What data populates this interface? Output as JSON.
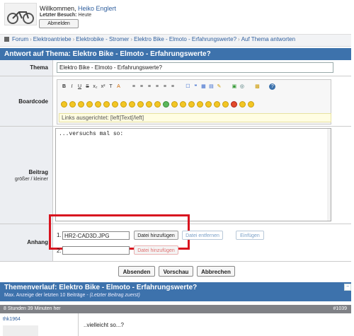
{
  "header": {
    "welcome_prefix": "Willkommen, ",
    "username": "Heiko Englert",
    "last_visit_label": "Letzter Besuch:",
    "last_visit_value": "Heute",
    "logout_label": "Abmelden"
  },
  "breadcrumb": {
    "items": [
      "Forum",
      "Elektroantriebe",
      "Elektrobike - Stromer",
      "Elektro Bike - Elmoto - Erfahrungswerte?",
      "Auf Thema antworten"
    ],
    "separator": "›"
  },
  "form": {
    "title": "Antwort auf Thema: Elektro Bike - Elmoto - Erfahrungswerte?",
    "thema_label": "Thema",
    "thema_value": "Elektro Bike - Elmoto - Erfahrungswerte?",
    "boardcode_label": "Boardcode",
    "toolbar_glyphs": [
      "B",
      "I",
      "U",
      "S",
      "x₂",
      "x²",
      "T",
      "A",
      "≡",
      "≡",
      "≡",
      "≡",
      "≡",
      "≡",
      "☐",
      "❝",
      "▦",
      "▤",
      "✎",
      "▣",
      "◎",
      "▩",
      "?"
    ],
    "align_hint": "Links ausgerichtet: [left]Text[/left]",
    "beitrag_label": "Beitrag",
    "beitrag_sub": "größer / kleiner",
    "message_text": "...versuchs mal so:",
    "anhang_label": "Anhang",
    "attachment_1_num": "1.",
    "attachment_1_value": "HR2-CAD3D.JPG",
    "attachment_2_num": "2.",
    "attachment_2_value": "",
    "add_file_label": "Datei hinzufügen",
    "remove_file_label": "Datei entfernen",
    "insert_label": "Einfügen",
    "send_label": "Absenden",
    "preview_label": "Vorschau",
    "cancel_label": "Abbrechen"
  },
  "history": {
    "title": "Themenverlauf: Elektro Bike - Elmoto - Erfahrungswerte?",
    "subtitle_prefix": "Max. Anzeige der letzten 10 Beiträge - ",
    "subtitle_italic": "(Letzter Beitrag zuerst)",
    "collapse_glyph": "−",
    "time_ago": "8 Stunden 39 Minuten her",
    "post_number": "#1039",
    "post_user": "thk1964",
    "post_text": "..vielleicht so...?"
  }
}
